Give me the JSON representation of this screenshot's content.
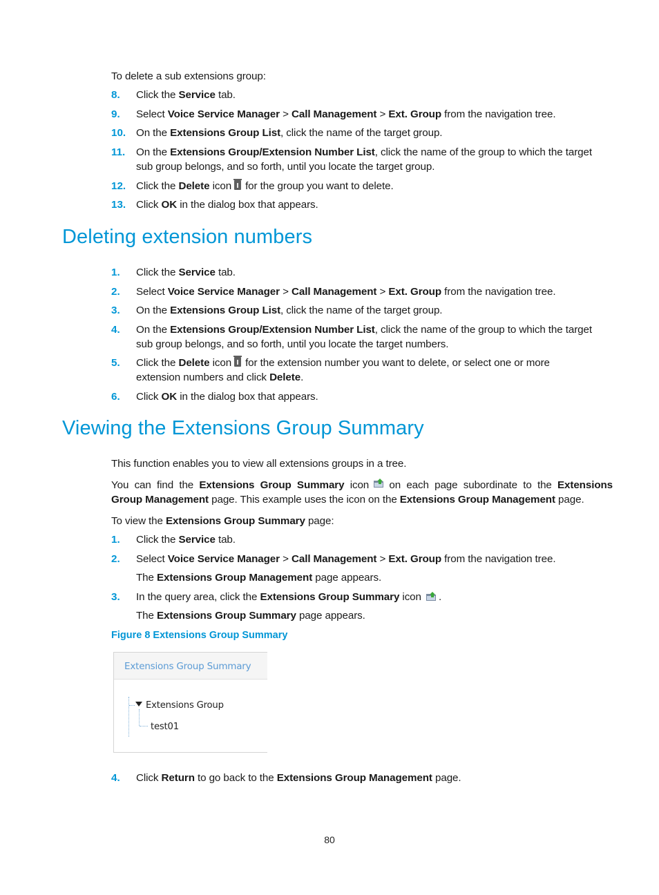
{
  "intro": "To delete a sub extensions group:",
  "steps_a": [
    {
      "n": "8.",
      "parts": [
        [
          "Click the ",
          false
        ],
        [
          "Service",
          true
        ],
        [
          " tab.",
          false
        ]
      ]
    },
    {
      "n": "9.",
      "parts": [
        [
          "Select ",
          false
        ],
        [
          "Voice Service Manager",
          true
        ],
        [
          " > ",
          false
        ],
        [
          "Call Management",
          true
        ],
        [
          " > ",
          false
        ],
        [
          "Ext. Group",
          true
        ],
        [
          " from the navigation tree.",
          false
        ]
      ]
    },
    {
      "n": "10.",
      "parts": [
        [
          "On the ",
          false
        ],
        [
          "Extensions Group List",
          true
        ],
        [
          ", click the name of the target group.",
          false
        ]
      ]
    },
    {
      "n": "11.",
      "parts": [
        [
          "On the ",
          false
        ],
        [
          "Extensions Group/Extension Number List",
          true
        ],
        [
          ", click the name of the group to which the target",
          false
        ]
      ],
      "line2": "sub group belongs, and so forth, until you locate the target group."
    },
    {
      "n": "12.",
      "parts": [
        [
          "Click the ",
          false
        ],
        [
          "Delete",
          true
        ],
        [
          " icon",
          false
        ],
        [
          "@trash",
          false
        ],
        [
          "for the group you want to delete.",
          false
        ]
      ]
    },
    {
      "n": "13.",
      "parts": [
        [
          "Click ",
          false
        ],
        [
          "OK",
          true
        ],
        [
          " in the dialog box that appears.",
          false
        ]
      ]
    }
  ],
  "heading1": "Deleting extension numbers",
  "steps_b": [
    {
      "n": "1.",
      "parts": [
        [
          "Click the ",
          false
        ],
        [
          "Service",
          true
        ],
        [
          " tab.",
          false
        ]
      ]
    },
    {
      "n": "2.",
      "parts": [
        [
          "Select ",
          false
        ],
        [
          "Voice Service Manager",
          true
        ],
        [
          " > ",
          false
        ],
        [
          "Call Management",
          true
        ],
        [
          " > ",
          false
        ],
        [
          "Ext. Group",
          true
        ],
        [
          " from the navigation tree.",
          false
        ]
      ]
    },
    {
      "n": "3.",
      "parts": [
        [
          "On the ",
          false
        ],
        [
          "Extensions Group List",
          true
        ],
        [
          ", click the name of the target group.",
          false
        ]
      ]
    },
    {
      "n": "4.",
      "parts": [
        [
          "On the ",
          false
        ],
        [
          "Extensions Group/Extension Number List",
          true
        ],
        [
          ", click the name of the group to which the target",
          false
        ]
      ],
      "line2": "sub group belongs, and so forth, until you locate the target numbers."
    },
    {
      "n": "5.",
      "parts": [
        [
          "Click the ",
          false
        ],
        [
          "Delete",
          true
        ],
        [
          " icon",
          false
        ],
        [
          "@trash",
          false
        ],
        [
          "for the extension number you want to delete, or select one or more",
          false
        ]
      ],
      "line2parts": [
        [
          "extension numbers and click ",
          false
        ],
        [
          "Delete",
          true
        ],
        [
          ".",
          false
        ]
      ]
    },
    {
      "n": "6.",
      "parts": [
        [
          "Click ",
          false
        ],
        [
          "OK",
          true
        ],
        [
          " in the dialog box that appears.",
          false
        ]
      ]
    }
  ],
  "heading2": "Viewing the Extensions Group Summary",
  "para1": "This function enables you to view all extensions groups in a tree.",
  "para2_line1": [
    [
      "You  can  find  the  ",
      false
    ],
    [
      "Extensions  Group  Summary",
      true
    ],
    [
      "  icon ",
      false
    ],
    [
      "@summary",
      false
    ],
    [
      " on  each  page  subordinate  to  the  ",
      false
    ],
    [
      "Extensions",
      true
    ]
  ],
  "para2_line2": [
    [
      "Group Management",
      true
    ],
    [
      " page. This example uses the icon on the ",
      false
    ],
    [
      "Extensions Group Management",
      true
    ],
    [
      " page.",
      false
    ]
  ],
  "para3": [
    [
      "To view the ",
      false
    ],
    [
      "Extensions Group Summary",
      true
    ],
    [
      " page:",
      false
    ]
  ],
  "steps_c": [
    {
      "n": "1.",
      "parts": [
        [
          "Click the ",
          false
        ],
        [
          "Service",
          true
        ],
        [
          " tab.",
          false
        ]
      ]
    },
    {
      "n": "2.",
      "parts": [
        [
          "Select ",
          false
        ],
        [
          "Voice Service Manager",
          true
        ],
        [
          " > ",
          false
        ],
        [
          "Call Management",
          true
        ],
        [
          " > ",
          false
        ],
        [
          "Ext. Group",
          true
        ],
        [
          " from the navigation tree.",
          false
        ]
      ]
    },
    {
      "n": "",
      "parts": [
        [
          "The ",
          false
        ],
        [
          "Extensions Group Management",
          true
        ],
        [
          " page appears.",
          false
        ]
      ]
    },
    {
      "n": "3.",
      "parts": [
        [
          "In the query area, click the ",
          false
        ],
        [
          "Extensions Group Summary",
          true
        ],
        [
          " icon ",
          false
        ],
        [
          "@summary",
          false
        ],
        [
          ".",
          false
        ]
      ]
    },
    {
      "n": "",
      "parts": [
        [
          "The ",
          false
        ],
        [
          "Extensions Group Summary",
          true
        ],
        [
          " page appears.",
          false
        ]
      ]
    }
  ],
  "figure_caption": "Figure 8 Extensions Group Summary",
  "figure": {
    "panel_title": "Extensions Group Summary",
    "tree_root": "Extensions Group",
    "tree_child": "test01"
  },
  "step_final": {
    "n": "4.",
    "parts": [
      [
        "Click ",
        false
      ],
      [
        "Return",
        true
      ],
      [
        " to go back to the ",
        false
      ],
      [
        "Extensions Group Management",
        true
      ],
      [
        " page.",
        false
      ]
    ]
  },
  "page_number": "80",
  "colors": {
    "accent": "#0096d6",
    "figure_title": "#5b9bd5"
  }
}
